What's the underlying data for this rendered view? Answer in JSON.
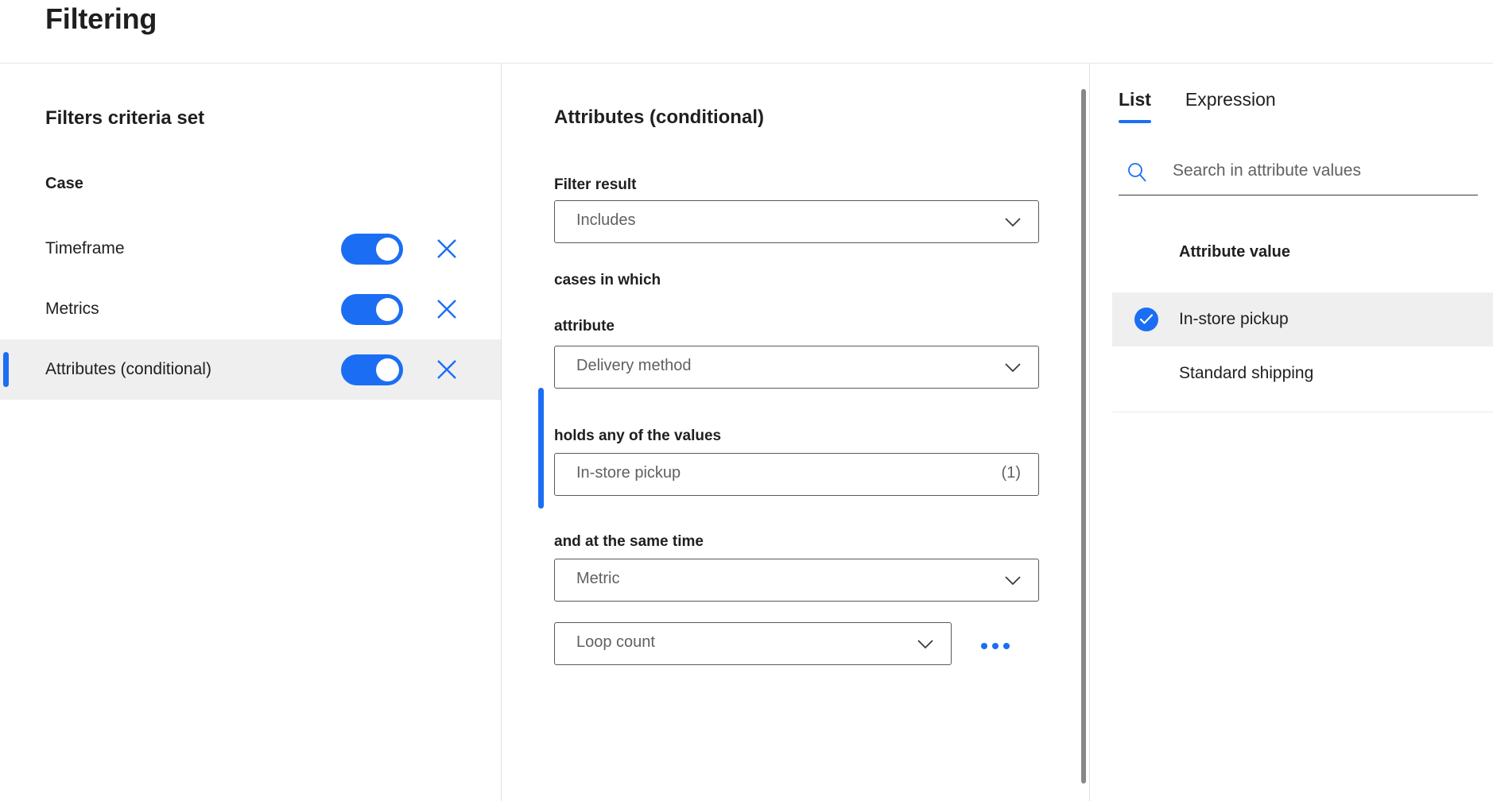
{
  "header": {
    "title": "Filtering"
  },
  "left_panel": {
    "heading": "Filters criteria set",
    "subheading": "Case",
    "criteria": [
      {
        "label": "Timeframe",
        "enabled": true,
        "selected": false,
        "remove_icon": "close-icon"
      },
      {
        "label": "Metrics",
        "enabled": true,
        "selected": false,
        "remove_icon": "close-icon"
      },
      {
        "label": "Attributes (conditional)",
        "enabled": true,
        "selected": true,
        "remove_icon": "close-icon"
      }
    ]
  },
  "middle_panel": {
    "heading": "Attributes (conditional)",
    "filter_result_label": "Filter result",
    "filter_result_value": "Includes",
    "phrase_cases_in_which": "cases in which",
    "attribute_label": "attribute",
    "attribute_value": "Delivery method",
    "holds_label": "holds any of the values",
    "holds_value": "In-store pickup",
    "holds_count": "(1)",
    "same_time_label": "and at the same time",
    "metric_value": "Metric",
    "loop_value": "Loop count",
    "more_options_icon": "ellipsis-icon",
    "chevron_icon": "chevron-down-icon"
  },
  "right_panel": {
    "tabs": [
      {
        "label": "List",
        "active": true
      },
      {
        "label": "Expression",
        "active": false
      }
    ],
    "search": {
      "icon": "search-icon",
      "placeholder": "Search in attribute values",
      "value": ""
    },
    "column_header": "Attribute value",
    "values": [
      {
        "label": "In-store pickup",
        "selected": true,
        "icon": "check-circle-icon"
      },
      {
        "label": "Standard shipping",
        "selected": false,
        "icon": ""
      }
    ]
  },
  "colors": {
    "accent": "#1b6ef3",
    "selected_row_bg": "#efefef",
    "border": "#595959",
    "text": "#201f1e",
    "muted_text": "#616161"
  }
}
